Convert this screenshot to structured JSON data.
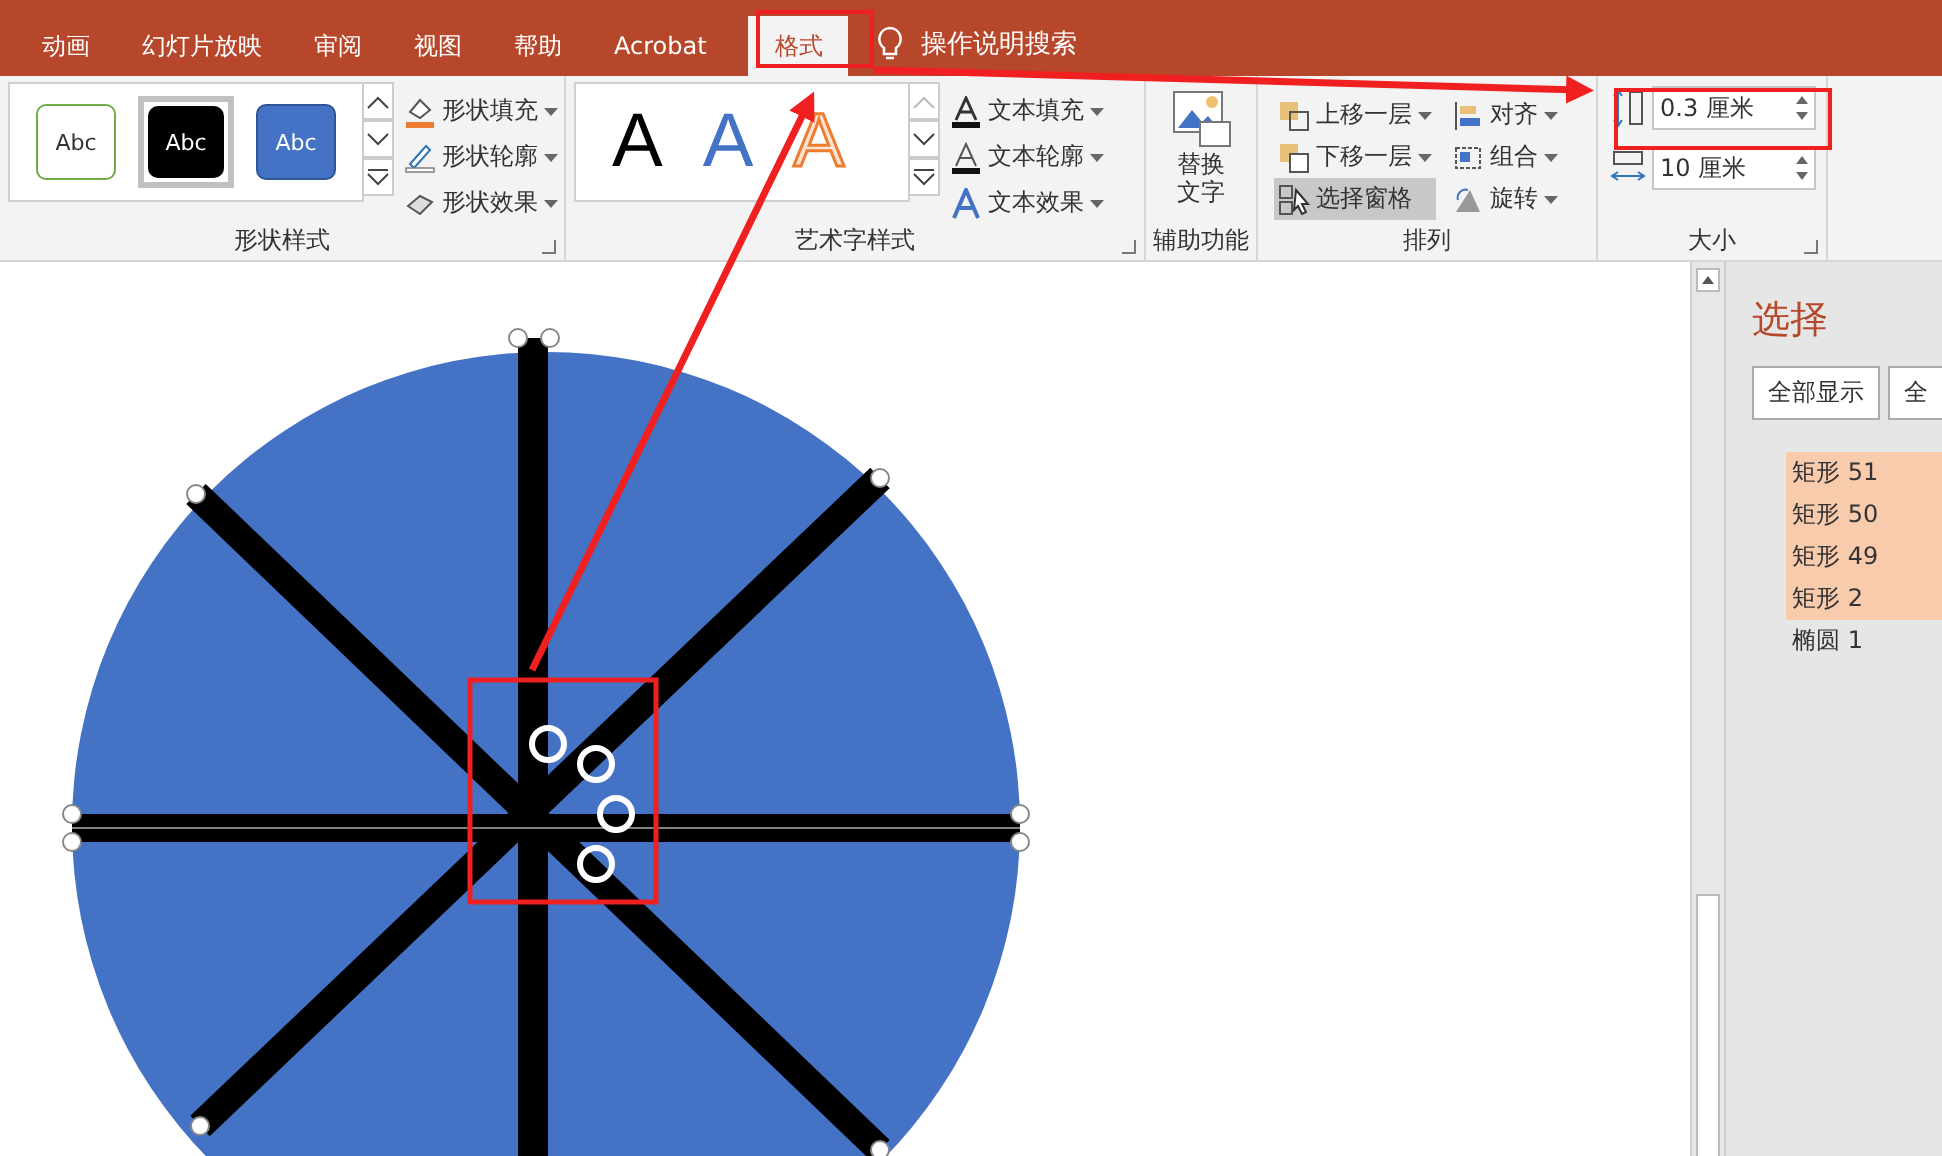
{
  "tabs": [
    {
      "label": "动画",
      "selected": false
    },
    {
      "label": "幻灯片放映",
      "selected": false
    },
    {
      "label": "审阅",
      "selected": false
    },
    {
      "label": "视图",
      "selected": false
    },
    {
      "label": "帮助",
      "selected": false
    },
    {
      "label": "Acrobat",
      "selected": false
    },
    {
      "label": "格式",
      "selected": true
    }
  ],
  "tell_me": "操作说明搜索",
  "groups": {
    "shape_styles": {
      "label": "形状样式",
      "samples": [
        {
          "text": "Abc",
          "kind": "outline",
          "selected": false
        },
        {
          "text": "Abc",
          "kind": "dark",
          "selected": true
        },
        {
          "text": "Abc",
          "kind": "blue",
          "selected": false
        }
      ],
      "commands": [
        {
          "label": "形状填充",
          "kind": "fill"
        },
        {
          "label": "形状轮廓",
          "kind": "outline"
        },
        {
          "label": "形状效果",
          "kind": "effect"
        }
      ]
    },
    "wordart_styles": {
      "label": "艺术字样式",
      "samples": [
        {
          "text": "A",
          "kind": "black"
        },
        {
          "text": "A",
          "kind": "blue"
        },
        {
          "text": "A",
          "kind": "orange"
        }
      ],
      "commands": [
        {
          "label": "文本填充",
          "kind": "fill"
        },
        {
          "label": "文本轮廓",
          "kind": "outline"
        },
        {
          "label": "文本效果",
          "kind": "effect"
        }
      ]
    },
    "accessibility": {
      "label": "辅助功能",
      "button": "替换文字"
    },
    "arrange": {
      "label": "排列",
      "commands": [
        {
          "label": "上移一层",
          "kind": "forward",
          "selected": false
        },
        {
          "label": "对齐",
          "kind": "align",
          "selected": false
        },
        {
          "label": "下移一层",
          "kind": "backward",
          "selected": false
        },
        {
          "label": "组合",
          "kind": "group",
          "selected": false
        },
        {
          "label": "选择窗格",
          "kind": "pane",
          "selected": true
        },
        {
          "label": "旋转",
          "kind": "rotate",
          "selected": false
        }
      ]
    },
    "size": {
      "label": "大小",
      "height": "0.3 厘米",
      "width": "10 厘米"
    }
  },
  "selection_pane": {
    "title": "选择",
    "buttons": [
      "全部显示",
      "全"
    ],
    "items": [
      {
        "label": "矩形 51",
        "selected": true
      },
      {
        "label": "矩形 50",
        "selected": true
      },
      {
        "label": "矩形 49",
        "selected": true
      },
      {
        "label": "矩形 2",
        "selected": true
      },
      {
        "label": "椭圆 1",
        "selected": false
      }
    ]
  }
}
